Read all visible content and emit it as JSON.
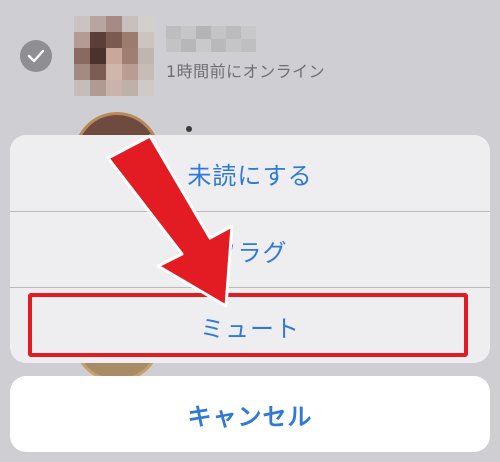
{
  "background": {
    "contact_status": "1時間前にオンライン"
  },
  "action_sheet": {
    "items": [
      {
        "label": "未読にする"
      },
      {
        "label": "フラグ"
      },
      {
        "label": "ミュート"
      }
    ],
    "cancel_label": "キャンセル"
  },
  "colors": {
    "accent": "#2f7ad8",
    "highlight": "#e31b23",
    "sheet_bg": "#eeeef0",
    "backdrop": "#cfcfd3"
  },
  "icons": [
    "checkmark-icon",
    "down-arrow-annotation"
  ]
}
